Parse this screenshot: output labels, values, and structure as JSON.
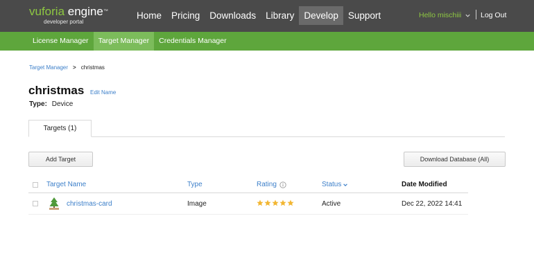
{
  "brand": {
    "name": "vuforia",
    "product": "engine",
    "tm": "™",
    "subtitle": "developer portal"
  },
  "nav": {
    "items": [
      {
        "label": "Home"
      },
      {
        "label": "Pricing"
      },
      {
        "label": "Downloads"
      },
      {
        "label": "Library"
      },
      {
        "label": "Develop",
        "active": true
      },
      {
        "label": "Support"
      }
    ]
  },
  "user": {
    "greeting": "Hello mischiii",
    "logout": "Log Out"
  },
  "subnav": {
    "items": [
      {
        "label": "License Manager"
      },
      {
        "label": "Target Manager",
        "active": true
      },
      {
        "label": "Credentials Manager"
      }
    ]
  },
  "breadcrumb": {
    "parent": "Target Manager",
    "separator": ">",
    "current": "christmas"
  },
  "page": {
    "title": "christmas",
    "edit_label": "Edit Name",
    "type_label": "Type:",
    "type_value": "Device"
  },
  "tabs": [
    {
      "label": "Targets (1)",
      "active": true
    }
  ],
  "actions": {
    "add_target": "Add Target",
    "download_database": "Download Database (All)"
  },
  "table": {
    "columns": {
      "name": "Target Name",
      "type": "Type",
      "rating": "Rating",
      "status": "Status",
      "date": "Date Modified"
    },
    "rows": [
      {
        "name": "christmas-card",
        "type": "Image",
        "rating": 5,
        "status": "Active",
        "date": "Dec 22, 2022 14:41"
      }
    ]
  },
  "colors": {
    "header_bg": "#4a4a4a",
    "subnav_bg": "#5ea63c",
    "brand_green": "#8ec742",
    "link_blue": "#3c7fc9",
    "star_gold": "#f2b632"
  }
}
